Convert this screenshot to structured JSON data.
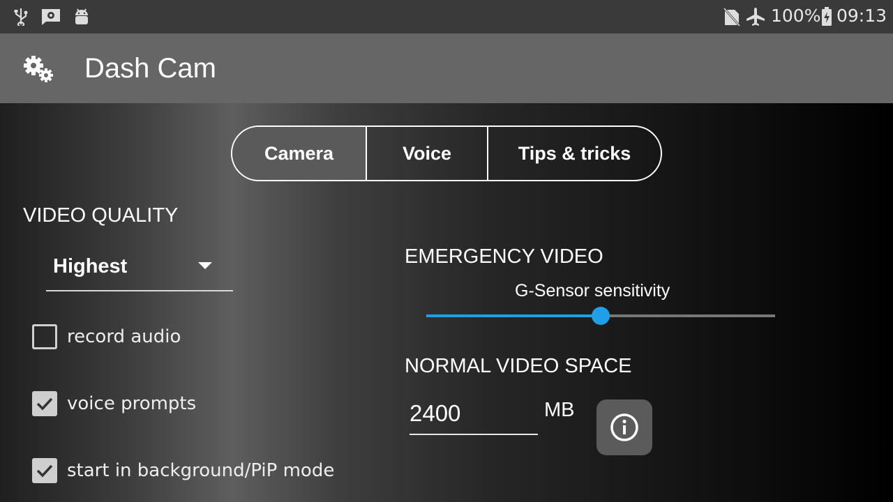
{
  "status_bar": {
    "left_icons": [
      "usb-icon",
      "settings-notification-icon",
      "android-debug-icon"
    ],
    "right_icons": [
      "no-sim-icon",
      "airplane-mode-icon",
      "battery-charging-icon"
    ],
    "battery": "100%",
    "time": "09:13"
  },
  "app_bar": {
    "icon": "gears-icon",
    "title": "Dash Cam"
  },
  "tabs": [
    {
      "label": "Camera",
      "selected": true
    },
    {
      "label": "Voice",
      "selected": false
    },
    {
      "label": "Tips & tricks",
      "selected": false
    }
  ],
  "video_quality": {
    "heading": "VIDEO QUALITY",
    "selected": "Highest"
  },
  "options": [
    {
      "label": "record audio",
      "checked": false
    },
    {
      "label": "voice prompts",
      "checked": true
    },
    {
      "label": "start in background/PiP mode",
      "checked": true
    }
  ],
  "emergency_video": {
    "heading": "EMERGENCY VIDEO",
    "slider_label": "G-Sensor sensitivity",
    "slider_value": 0.5
  },
  "normal_video_space": {
    "heading": "NORMAL VIDEO SPACE",
    "value": "2400",
    "unit": "MB"
  },
  "info_button": {
    "icon": "info-icon"
  },
  "colors": {
    "accent": "#1e9fe8",
    "appbar": "#666666",
    "statusbar": "#3a3a3a"
  }
}
